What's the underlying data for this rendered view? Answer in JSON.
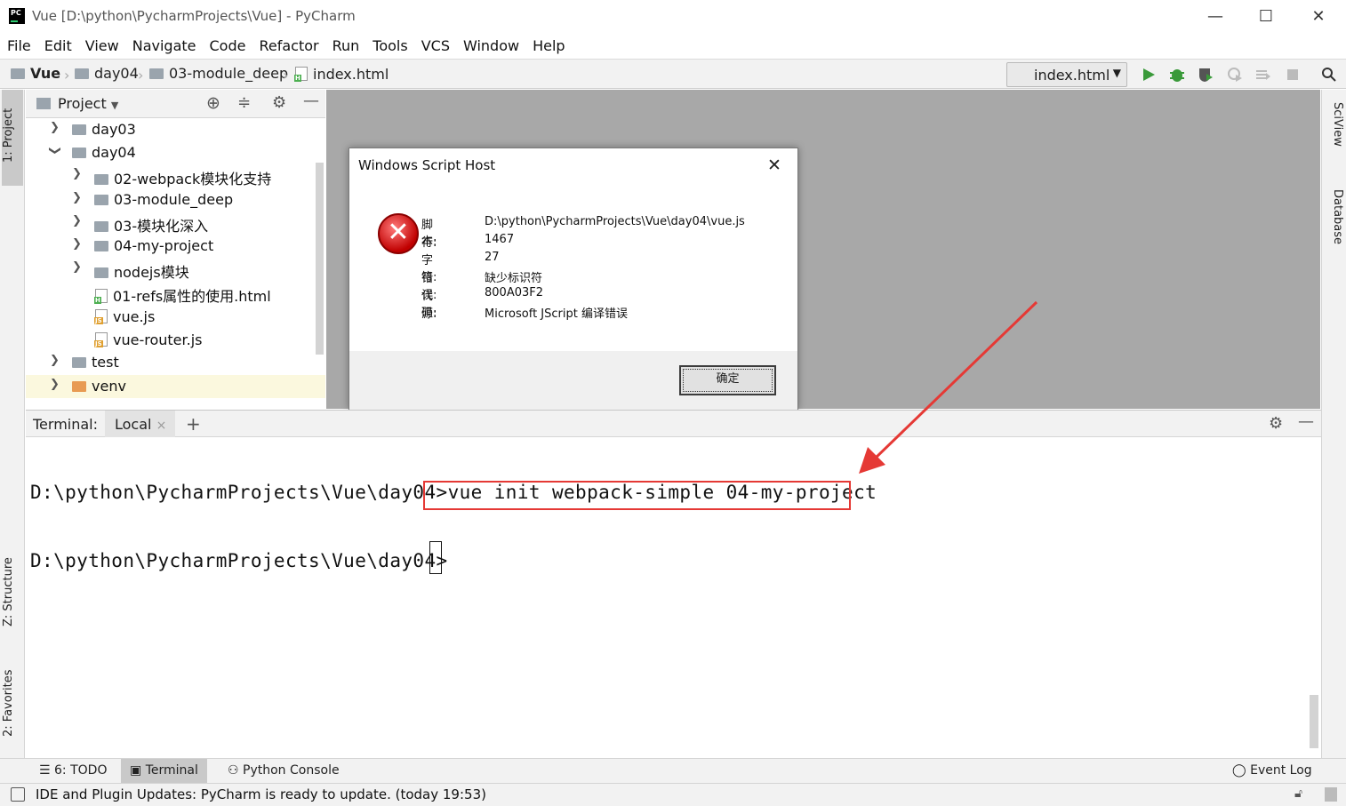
{
  "window": {
    "title": "Vue [D:\\python\\PycharmProjects\\Vue] - PyCharm",
    "minimize": "—",
    "maximize": "☐",
    "close": "✕"
  },
  "menu": [
    "File",
    "Edit",
    "View",
    "Navigate",
    "Code",
    "Refactor",
    "Run",
    "Tools",
    "VCS",
    "Window",
    "Help"
  ],
  "breadcrumb": {
    "project": "Vue",
    "folder1": "day04",
    "folder2": "03-module_deep",
    "file": "index.html"
  },
  "run_config": "index.html",
  "project_panel": {
    "title": "Project",
    "tree": [
      {
        "label": "day03",
        "kind": "folder",
        "expanded": false
      },
      {
        "label": "day04",
        "kind": "folder",
        "expanded": true
      },
      {
        "label": "02-webpack模块化支持",
        "kind": "folder",
        "expanded": false
      },
      {
        "label": "03-module_deep",
        "kind": "folder",
        "expanded": false
      },
      {
        "label": "03-模块化深入",
        "kind": "folder",
        "expanded": false
      },
      {
        "label": "04-my-project",
        "kind": "folder",
        "expanded": false
      },
      {
        "label": "nodejs模块",
        "kind": "folder",
        "expanded": false
      },
      {
        "label": "01-refs属性的使用.html",
        "kind": "html"
      },
      {
        "label": "vue.js",
        "kind": "js"
      },
      {
        "label": "vue-router.js",
        "kind": "js"
      },
      {
        "label": "test",
        "kind": "folder",
        "expanded": false
      },
      {
        "label": "venv",
        "kind": "folder-orange",
        "expanded": false
      }
    ]
  },
  "left_tabs": {
    "project": "1: Project",
    "structure": "Z: Structure",
    "favorites": "2: Favorites"
  },
  "right_tabs": {
    "sciview": "SciView",
    "database": "Database"
  },
  "dialog": {
    "title": "Windows Script Host",
    "rows": [
      {
        "key": "脚本:",
        "value": "D:\\python\\PycharmProjects\\Vue\\day04\\vue.js"
      },
      {
        "key": "行:",
        "value": "1467"
      },
      {
        "key": "字符:",
        "value": "27"
      },
      {
        "key": "错误:",
        "value": "缺少标识符"
      },
      {
        "key": "代码:",
        "value": "800A03F2"
      },
      {
        "key": "源:",
        "value": "Microsoft JScript 编译错误"
      }
    ],
    "ok_label": "确定",
    "close": "✕"
  },
  "terminal": {
    "label": "Terminal:",
    "tab": "Local",
    "tab_close": "×",
    "add": "+",
    "prompt": "D:\\python\\PycharmProjects\\Vue\\day04>",
    "command": "vue init webpack-simple 04-my-project"
  },
  "bottom_tabs": {
    "todo": "6: TODO",
    "terminal": "Terminal",
    "python_console": "Python Console",
    "event_log": "Event Log"
  },
  "status_message": "IDE and Plugin Updates: PyCharm is ready to update. (today 19:53)",
  "colors": {
    "highlight_box": "#e53935",
    "arrow": "#e53935",
    "editor_bg": "#a8a8a8"
  }
}
